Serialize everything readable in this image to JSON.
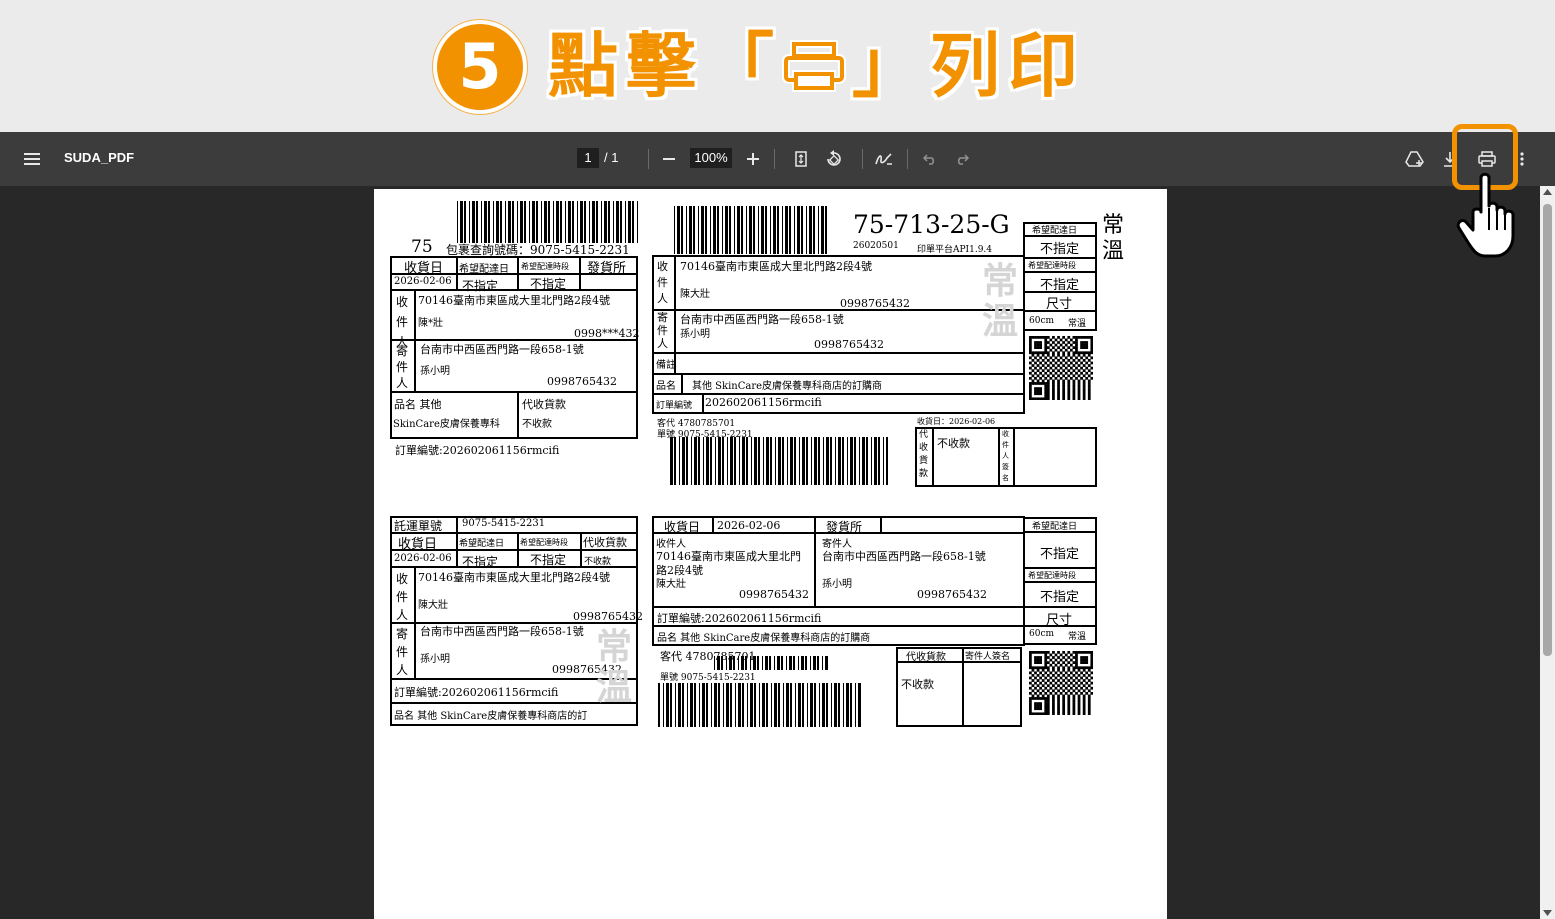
{
  "banner": {
    "step": "5",
    "text_before": "點擊「",
    "text_after": "」列印",
    "accent_color": "#f39200"
  },
  "toolbar": {
    "title": "SUDA_PDF",
    "page_current": "1",
    "page_total": "/ 1",
    "zoom": "100%",
    "icons": [
      "menu-icon",
      "zoom-out-icon",
      "zoom-in-icon",
      "fit-page-icon",
      "rotate-icon",
      "annotate-icon",
      "undo-icon",
      "redo-icon",
      "save-to-drive-icon",
      "download-icon",
      "print-icon",
      "more-icon"
    ]
  },
  "label1": {
    "route_prefix": "75",
    "tracking_caption": "包裹查詢號碼：9075-5415-2231",
    "h_received": "收貨日",
    "h_hope_date": "希望配達日",
    "h_hope_slot": "希望配達時段",
    "h_ship_office": "發貨所",
    "received_date": "2026-02-06",
    "hope_date": "不指定",
    "hope_slot": "不指定",
    "recipient_label": "收件人",
    "recipient_addr": "70146臺南市東區成大里北門路2段4號",
    "recipient_name": "陳*壯",
    "recipient_phone": "0998***432",
    "sender_label": "寄件人",
    "sender_addr": "台南市中西區西門路一段658-1號",
    "sender_name": "孫小明",
    "sender_phone": "0998765432",
    "item_label": "品名 其他",
    "item_name": "SkinCare皮膚保養專科",
    "cod_label": "代收貨款",
    "cod_value": "不收款",
    "order_no": "訂單編號:202602061156rmcifi"
  },
  "label2": {
    "code": "75-713-25-G",
    "sub_code": "26020501",
    "platform": "印單平台API1.9.4",
    "hope_date_label": "希望配達日",
    "hope_date": "不指定",
    "hope_slot_label": "希望配達時段",
    "hope_slot": "不指定",
    "size_label": "尺寸",
    "size": "60cm",
    "temp": "常溫",
    "temp_big": "常\n溫",
    "recipient_label": "收件人",
    "recipient_addr": "70146臺南市東區成大里北門路2段4號",
    "recipient_name": "陳大壯",
    "recipient_phone": "0998765432",
    "sender_label": "寄件人",
    "sender_addr": "台南市中西區西門路一段658-1號",
    "sender_name": "孫小明",
    "sender_phone": "0998765432",
    "remark_label": "備註",
    "item_label": "品名",
    "item_value": "其他 SkinCare皮膚保養專科商店的訂購商",
    "order_label": "訂單編號",
    "order_no": "202602061156rmcifi",
    "customer_code": "客代 4780785701",
    "waybill": "單號 9075-5415-2231",
    "received": "收貨日：2026-02-06",
    "cod_label": "代收貨款",
    "cod_value": "不收款",
    "sign_label": "收件人簽名"
  },
  "label3": {
    "waybill_label": "託運單號",
    "waybill": "9075-5415-2231",
    "h_received": "收貨日",
    "h_hope_date": "希望配達日",
    "h_hope_slot": "希望配達時段",
    "h_cod": "代收貨款",
    "received_date": "2026-02-06",
    "hope_date": "不指定",
    "hope_slot": "不指定",
    "cod_value": "不收款",
    "recipient_label": "收件人",
    "recipient_addr": "70146臺南市東區成大里北門路2段4號",
    "recipient_name": "陳大壯",
    "recipient_phone": "0998765432",
    "sender_label": "寄件人",
    "sender_addr": "台南市中西區西門路一段658-1號",
    "sender_name": "孫小明",
    "sender_phone": "0998765432",
    "order_no": "訂單編號:202602061156rmcifi",
    "item": "品名 其他 SkinCare皮膚保養專科商店的訂"
  },
  "label4": {
    "received_label": "收貨日",
    "received_date": "2026-02-06",
    "ship_office": "發貨所",
    "recipient_label": "收件人",
    "recipient_addr1": "70146臺南市東區成大里北門",
    "recipient_addr2": "路2段4號",
    "recipient_name": "陳大壯",
    "recipient_phone": "0998765432",
    "sender_label": "寄件人",
    "sender_addr": "台南市中西區西門路一段658-1號",
    "sender_name": "孫小明",
    "sender_phone": "0998765432",
    "order_no": "訂單編號:202602061156rmcifi",
    "item": "品名 其他 SkinCare皮膚保養專科商店的訂購商",
    "hope_date_label": "希望配達日",
    "hope_date": "不指定",
    "hope_slot_label": "希望配達時段",
    "hope_slot": "不指定",
    "size_label": "尺寸",
    "size": "60cm",
    "temp": "常溫",
    "customer_code": "客代 4780785701",
    "waybill": "單號 9075-5415-2231",
    "cod_label": "代收貨款",
    "cod_value": "不收款",
    "sign_label": "寄件人簽名"
  },
  "watermark": "常\n溫"
}
